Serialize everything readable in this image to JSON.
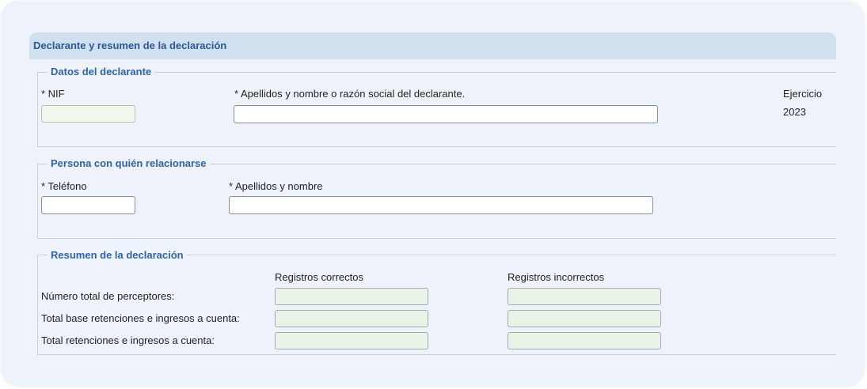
{
  "header": {
    "title": "Declarante y resumen de la declaración"
  },
  "declarante": {
    "legend": "Datos del declarante",
    "nif_label": "* NIF",
    "nif_value": "",
    "nombre_label": "* Apellidos y nombre o razón social del declarante.",
    "nombre_value": "",
    "ejercicio_label": "Ejercicio",
    "ejercicio_value": "2023"
  },
  "persona": {
    "legend": "Persona con quién relacionarse",
    "telefono_label": "* Teléfono",
    "telefono_value": "",
    "nombre_label": "* Apellidos y nombre",
    "nombre_value": ""
  },
  "resumen": {
    "legend": "Resumen de la declaración",
    "col_correctos": "Registros correctos",
    "col_incorrectos": "Registros incorrectos",
    "rows": [
      {
        "label": "Número total de perceptores:",
        "correctos": "",
        "incorrectos": ""
      },
      {
        "label": "Total base retenciones e ingresos a cuenta:",
        "correctos": "",
        "incorrectos": ""
      },
      {
        "label": "Total retenciones e ingresos a cuenta:",
        "correctos": "",
        "incorrectos": ""
      }
    ]
  }
}
